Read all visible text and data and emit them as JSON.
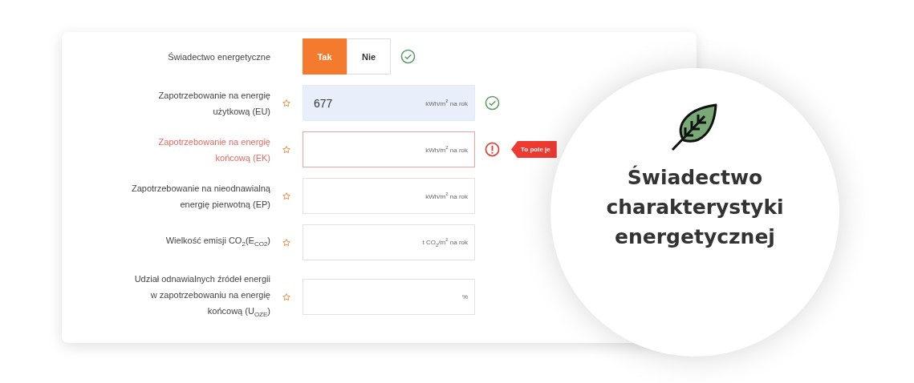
{
  "toggle": {
    "label": "Świadectwo energetyczne",
    "options": [
      {
        "label": "Tak",
        "selected": true
      },
      {
        "label": "Nie",
        "selected": false
      }
    ],
    "valid": true
  },
  "fields": [
    {
      "label": "Zapotrzebowanie na energię użytkową (EU)",
      "required": true,
      "value": "677",
      "unit": "kWh/m$^{2}$ na rok",
      "valid": true,
      "error": false
    },
    {
      "label": "Zapotrzebowanie na energię końcową (EK)",
      "required": true,
      "unit": "kWh/m$^{2}$ na rok",
      "valid": false,
      "error": true,
      "error_message": "To pole je"
    },
    {
      "label": "Zapotrzebowanie na nieodnawialną energię pierwotną (EP)",
      "required": true,
      "unit": "kWh/m$^{2}$ na rok",
      "valid": false,
      "error": false
    },
    {
      "label": "Wielkość emisji CO$_{2}$(E$_{CO2}$)",
      "required": true,
      "unit": "t CO$_{2}$/m$^{2}$ na rok",
      "valid": false,
      "error": false
    },
    {
      "label": "Udział odnawialnych źródeł energii w zapotrzebowaniu na energię końcową (U$_{OZE}$)",
      "required": true,
      "unit": "%",
      "valid": false,
      "error": false
    }
  ],
  "badge": {
    "title": "Świadectwo charakterystyki energetycznej"
  }
}
